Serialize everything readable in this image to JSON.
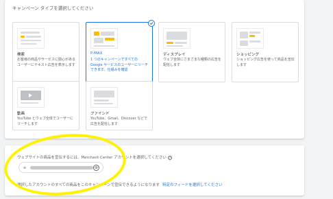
{
  "section": {
    "title": "キャンペーン タイプを選択してください"
  },
  "campaign_types": [
    {
      "name": "検索",
      "desc": "お客様の商品やサービスに関心があるユーザーにテキスト広告を表示します"
    },
    {
      "name": "P-MAX",
      "desc": "1 つのキャンペーンですべての Google サービスのユーザーにリーチできます。仕組みを確認"
    },
    {
      "name": "ディスプレイ",
      "desc": "ウェブ全体にさまざまな種類の広告を配信します"
    },
    {
      "name": "ショッピング",
      "desc": "ショッピング広告を使って商品を宣伝します"
    },
    {
      "name": "動画",
      "desc": "YouTube とウェブ全体でユーザーにリーチします"
    },
    {
      "name": "ファインド",
      "desc": "YouTube、Gmail、Discover などで広告を配信します"
    }
  ],
  "merchant": {
    "label": "ウェブサイトの商品を宣伝するには、Merchant Center アカウントを選択してください",
    "help_icon": "?",
    "chip_clear": "⊗",
    "chip_grip": "≡",
    "footer_text": "選択したアカウントのすべての商品をこのキャンペーンで宣伝できるようになります",
    "footer_link": "特定のフィードを選択してください"
  },
  "colors": {
    "accent": "#1a73e8",
    "highlight": "#fff200"
  }
}
